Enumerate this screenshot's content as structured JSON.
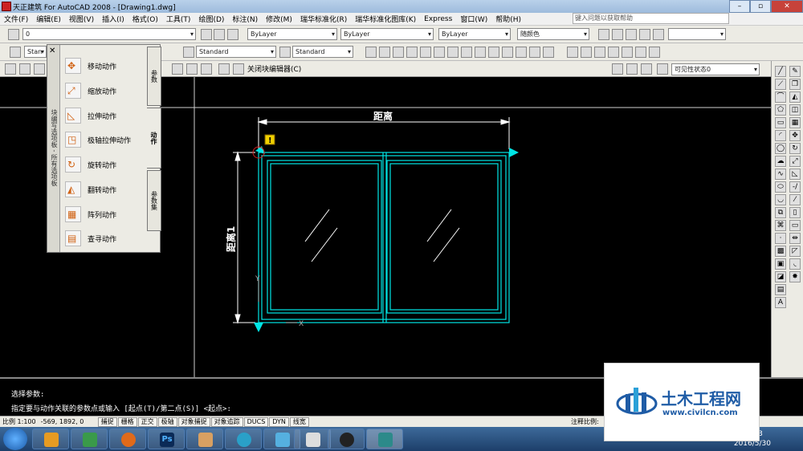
{
  "titlebar": {
    "title": "天正建筑 For AutoCAD 2008 - [Drawing1.dwg]"
  },
  "menubar": {
    "items": [
      "文件(F)",
      "编辑(E)",
      "视图(V)",
      "插入(I)",
      "格式(O)",
      "工具(T)",
      "绘图(D)",
      "标注(N)",
      "修改(M)",
      "瑞华标准化(R)",
      "瑞华标准化图库(K)",
      "Express",
      "窗口(W)",
      "帮助(H)"
    ],
    "help_search_placeholder": "键入问题以获取帮助"
  },
  "toolbar1": {
    "layer_combo": "0",
    "color_combo": "ByLayer",
    "linetype_combo": "ByLayer",
    "lineweight_combo": "ByLayer",
    "plotstyle_combo": "随颜色"
  },
  "toolbar2": {
    "text_style_combo": "Stan",
    "dim_style_combo": "Standard",
    "table_style_combo": "Standard"
  },
  "block_editor": {
    "close_label": "关闭块编辑器(C)",
    "visibility_state": "可见性状态0"
  },
  "palette": {
    "vertical_title": "块编写选项板 - 所有选项板",
    "actions": [
      "移动动作",
      "缩放动作",
      "拉伸动作",
      "极轴拉伸动作",
      "旋转动作",
      "翻转动作",
      "阵列动作",
      "查寻动作"
    ],
    "tabs": [
      "参数",
      "动作",
      "参数集"
    ]
  },
  "drawing": {
    "dim_horizontal": "距离",
    "dim_vertical": "距离1",
    "warning_glyph": "!"
  },
  "cmdline": {
    "line1": "选择参数:",
    "line2": "指定要与动作关联的参数点或输入 [起点(T)/第二点(S)] <起点>:"
  },
  "statusbar": {
    "scale": "比例 1:100",
    "coords": "-569, 1892, 0",
    "toggles": [
      "捕捉",
      "栅格",
      "正交",
      "极轴",
      "对象捕捉",
      "对象追踪",
      "DUCS",
      "DYN",
      "线宽"
    ],
    "annotation_scale": "注释比例:"
  },
  "taskbar": {
    "time": "20:13",
    "date": "2016/5/30",
    "ps_label": "Ps"
  },
  "watermark": {
    "title": "土木工程网",
    "url": "www.civilcn.com"
  },
  "colors": {
    "cyan": "#00e5e5",
    "dim_white": "#ffffff",
    "accent_blue": "#1f5ca6"
  }
}
